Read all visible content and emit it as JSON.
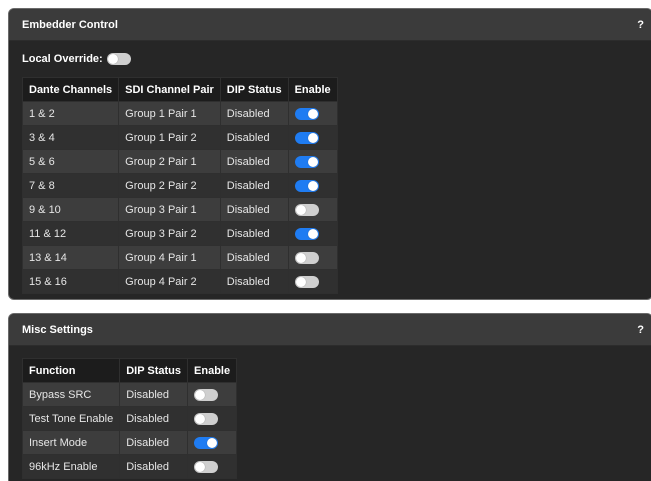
{
  "embedder": {
    "title": "Embedder Control",
    "help": "?",
    "local_override_label": "Local Override:",
    "local_override_on": false,
    "columns": [
      "Dante Channels",
      "SDI Channel Pair",
      "DIP Status",
      "Enable"
    ],
    "rows": [
      {
        "channels": "1 & 2",
        "pair": "Group 1 Pair 1",
        "dip": "Disabled",
        "enabled": true
      },
      {
        "channels": "3 & 4",
        "pair": "Group 1 Pair 2",
        "dip": "Disabled",
        "enabled": true
      },
      {
        "channels": "5 & 6",
        "pair": "Group 2 Pair 1",
        "dip": "Disabled",
        "enabled": true
      },
      {
        "channels": "7 & 8",
        "pair": "Group 2 Pair 2",
        "dip": "Disabled",
        "enabled": true
      },
      {
        "channels": "9 & 10",
        "pair": "Group 3 Pair 1",
        "dip": "Disabled",
        "enabled": false
      },
      {
        "channels": "11 & 12",
        "pair": "Group 3 Pair 2",
        "dip": "Disabled",
        "enabled": true
      },
      {
        "channels": "13 & 14",
        "pair": "Group 4 Pair 1",
        "dip": "Disabled",
        "enabled": false
      },
      {
        "channels": "15 & 16",
        "pair": "Group 4 Pair 2",
        "dip": "Disabled",
        "enabled": false
      }
    ]
  },
  "misc": {
    "title": "Misc Settings",
    "help": "?",
    "columns": [
      "Function",
      "DIP Status",
      "Enable"
    ],
    "rows": [
      {
        "function": "Bypass SRC",
        "dip": "Disabled",
        "enabled": false
      },
      {
        "function": "Test Tone Enable",
        "dip": "Disabled",
        "enabled": false
      },
      {
        "function": "Insert Mode",
        "dip": "Disabled",
        "enabled": true
      },
      {
        "function": "96kHz Enable",
        "dip": "Disabled",
        "enabled": false
      }
    ]
  },
  "colors": {
    "toggle_on": "#1f7cf2",
    "toggle_off": "#cfcfcf",
    "panel_bg": "#262626",
    "header_bg": "#3b3b3b"
  }
}
